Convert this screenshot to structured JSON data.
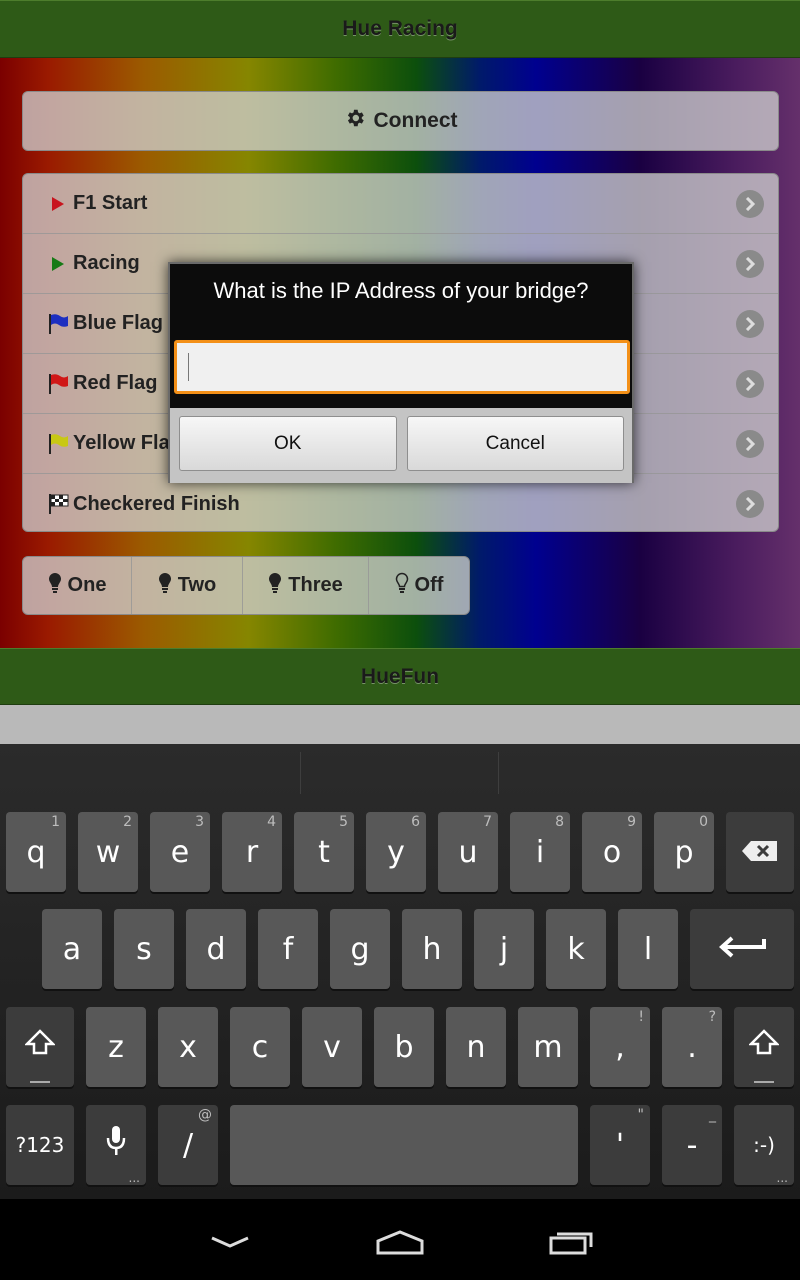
{
  "app": {
    "title": "Hue Racing",
    "footer_title": "HueFun"
  },
  "connect": {
    "label": "Connect",
    "icon": "gear-icon"
  },
  "race_items": [
    {
      "label": "F1 Start",
      "icon": "triangle-right-icon",
      "color": "#c8141e"
    },
    {
      "label": "Racing",
      "icon": "triangle-right-icon",
      "color": "#157a15"
    },
    {
      "label": "Blue Flag",
      "icon": "flag-icon",
      "color": "#1d2fc0"
    },
    {
      "label": "Red Flag",
      "icon": "flag-icon",
      "color": "#d01818"
    },
    {
      "label": "Yellow Flag",
      "icon": "flag-icon",
      "color": "#c8c814"
    },
    {
      "label": "Checkered Finish",
      "icon": "checkered-flag-icon",
      "color": "#222222"
    }
  ],
  "lights": [
    {
      "label": "One",
      "icon": "bulb-icon"
    },
    {
      "label": "Two",
      "icon": "bulb-icon"
    },
    {
      "label": "Three",
      "icon": "bulb-icon"
    },
    {
      "label": "Off",
      "icon": "bulb-outline-icon"
    }
  ],
  "dialog": {
    "title": "What is the IP Address of your bridge?",
    "input_value": "",
    "ok": "OK",
    "cancel": "Cancel"
  },
  "keyboard": {
    "row1": [
      {
        "key": "q",
        "hint": "1"
      },
      {
        "key": "w",
        "hint": "2"
      },
      {
        "key": "e",
        "hint": "3"
      },
      {
        "key": "r",
        "hint": "4"
      },
      {
        "key": "t",
        "hint": "5"
      },
      {
        "key": "y",
        "hint": "6"
      },
      {
        "key": "u",
        "hint": "7"
      },
      {
        "key": "i",
        "hint": "8"
      },
      {
        "key": "o",
        "hint": "9"
      },
      {
        "key": "p",
        "hint": "0"
      }
    ],
    "row2": [
      "a",
      "s",
      "d",
      "f",
      "g",
      "h",
      "j",
      "k",
      "l"
    ],
    "row3": [
      {
        "key": "z",
        "hint": ""
      },
      {
        "key": "x",
        "hint": ""
      },
      {
        "key": "c",
        "hint": ""
      },
      {
        "key": "v",
        "hint": ""
      },
      {
        "key": "b",
        "hint": ""
      },
      {
        "key": "n",
        "hint": ""
      },
      {
        "key": "m",
        "hint": ""
      },
      {
        "key": ",",
        "hint": "!"
      },
      {
        "key": ".",
        "hint": "?"
      }
    ],
    "symbols_label": "?123",
    "slash": {
      "key": "/",
      "hint": "@"
    },
    "apostrophe": {
      "key": "'",
      "hint": "\""
    },
    "dash": {
      "key": "-",
      "hint": "_"
    },
    "smiley": ":-)"
  },
  "colors": {
    "header_green": "#2e5a17",
    "dialog_focus": "#f39018"
  }
}
